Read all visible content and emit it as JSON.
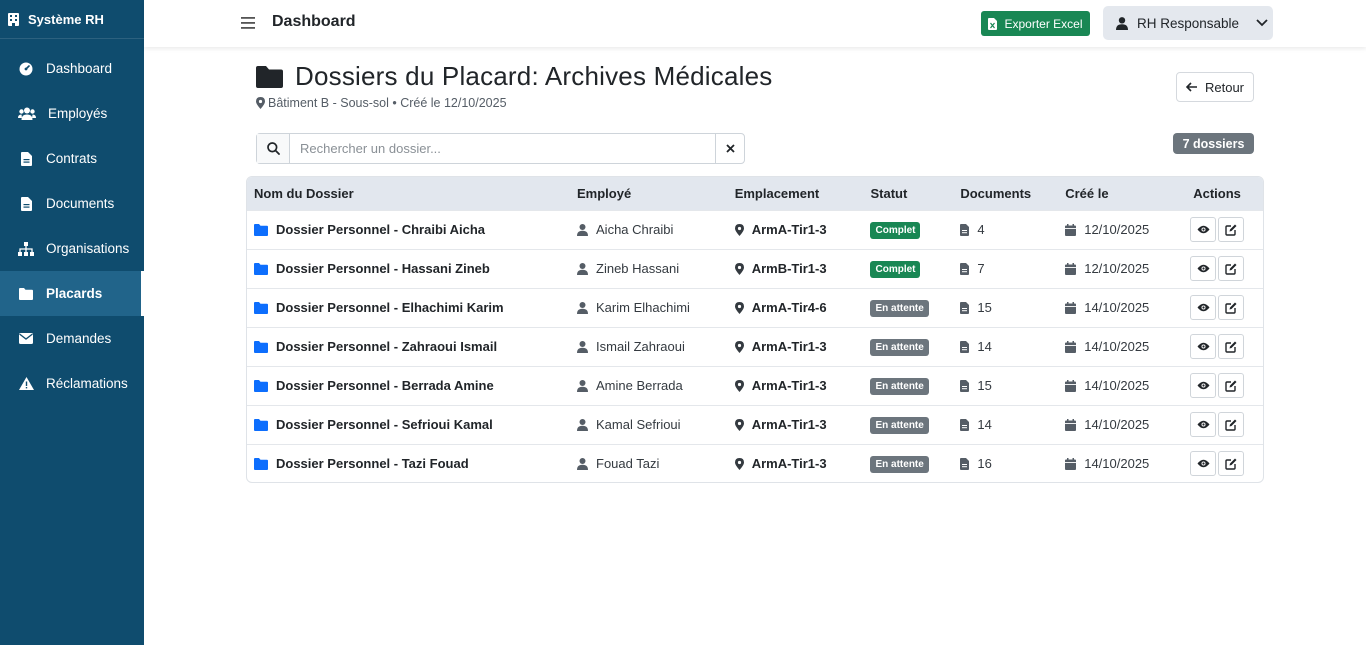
{
  "sidebar": {
    "brand": "Système RH",
    "items": [
      {
        "label": "Dashboard",
        "icon": "gauge-icon"
      },
      {
        "label": "Employés",
        "icon": "users-icon"
      },
      {
        "label": "Contrats",
        "icon": "file-icon"
      },
      {
        "label": "Documents",
        "icon": "file-icon"
      },
      {
        "label": "Organisations",
        "icon": "sitemap-icon"
      },
      {
        "label": "Placards",
        "icon": "folder-icon",
        "active": true
      },
      {
        "label": "Demandes",
        "icon": "envelope-icon"
      },
      {
        "label": "Réclamations",
        "icon": "warning-icon"
      }
    ]
  },
  "topbar": {
    "title": "Dashboard",
    "export_label": "Exporter Excel",
    "user_label": "RH Responsable"
  },
  "page": {
    "title": "Dossiers du Placard: Archives Médicales",
    "subtitle": "Bâtiment B - Sous-sol • Créé le 12/10/2025",
    "back_label": "Retour",
    "count_badge": "7 dossiers"
  },
  "search": {
    "placeholder": "Rechercher un dossier...",
    "value": ""
  },
  "table": {
    "headers": [
      "Nom du Dossier",
      "Employé",
      "Emplacement",
      "Statut",
      "Documents",
      "Créé le",
      "Actions"
    ],
    "rows": [
      {
        "name": "Dossier Personnel - Chraibi Aicha",
        "employee": "Aicha Chraibi",
        "location": "ArmA-Tir1-3",
        "status": "Complet",
        "status_type": "ok",
        "docs": "4",
        "created": "12/10/2025"
      },
      {
        "name": "Dossier Personnel - Hassani Zineb",
        "employee": "Zineb Hassani",
        "location": "ArmB-Tir1-3",
        "status": "Complet",
        "status_type": "ok",
        "docs": "7",
        "created": "12/10/2025"
      },
      {
        "name": "Dossier Personnel - Elhachimi Karim",
        "employee": "Karim Elhachimi",
        "location": "ArmA-Tir4-6",
        "status": "En attente",
        "status_type": "wait",
        "docs": "15",
        "created": "14/10/2025"
      },
      {
        "name": "Dossier Personnel - Zahraoui Ismail",
        "employee": "Ismail Zahraoui",
        "location": "ArmA-Tir1-3",
        "status": "En attente",
        "status_type": "wait",
        "docs": "14",
        "created": "14/10/2025"
      },
      {
        "name": "Dossier Personnel - Berrada Amine",
        "employee": "Amine Berrada",
        "location": "ArmA-Tir1-3",
        "status": "En attente",
        "status_type": "wait",
        "docs": "15",
        "created": "14/10/2025"
      },
      {
        "name": "Dossier Personnel - Sefrioui Kamal",
        "employee": "Kamal Sefrioui",
        "location": "ArmA-Tir1-3",
        "status": "En attente",
        "status_type": "wait",
        "docs": "14",
        "created": "14/10/2025"
      },
      {
        "name": "Dossier Personnel - Tazi Fouad",
        "employee": "Fouad Tazi",
        "location": "ArmA-Tir1-3",
        "status": "En attente",
        "status_type": "wait",
        "docs": "16",
        "created": "14/10/2025"
      }
    ]
  },
  "colors": {
    "sidebar_bg": "#0f4c6e",
    "sidebar_active": "#21648a",
    "success": "#198754",
    "secondary": "#6c757d",
    "folder_blue": "#0d6efd"
  }
}
